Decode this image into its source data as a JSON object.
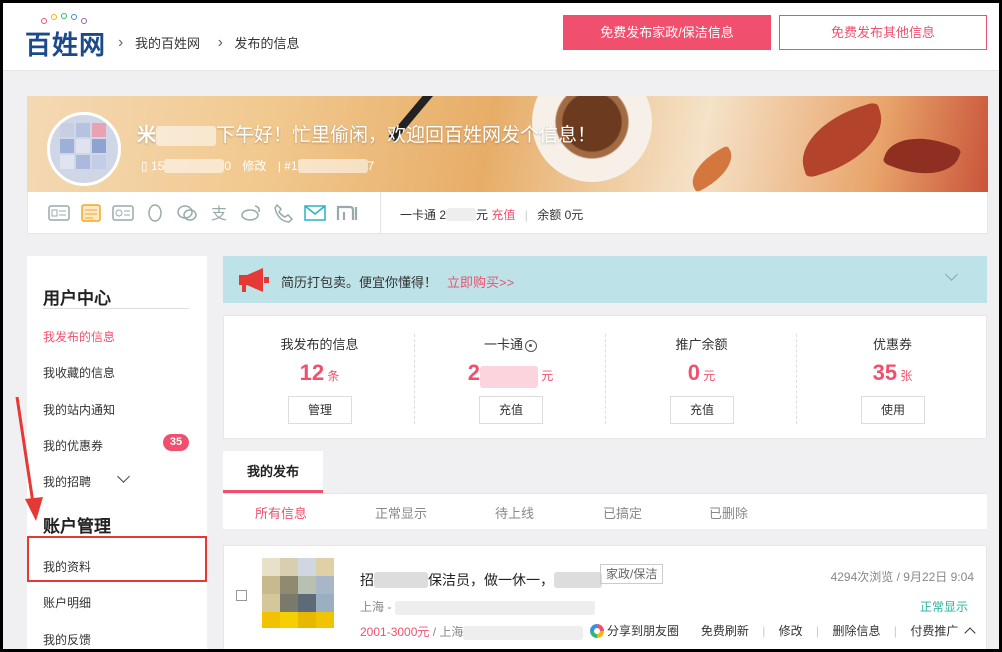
{
  "header": {
    "logo_text": "百姓网",
    "breadcrumb": [
      "我的百姓网",
      "发布的信息"
    ],
    "btn_primary": "免费发布家政/保洁信息",
    "btn_secondary": "免费发布其他信息"
  },
  "banner": {
    "name_prefix": "米",
    "greeting": "下午好！忙里偷闲，欢迎回百姓网发个信息！",
    "phone_prefix": "15",
    "phone_suffix": "0",
    "edit_label": "修改",
    "id_prefix": "#1",
    "id_suffix": "7"
  },
  "icons": [
    "id-card-icon",
    "notepad-icon",
    "card-icon",
    "qq-icon",
    "wechat-icon",
    "alipay-icon",
    "weibo-icon",
    "phone-icon",
    "mail-icon",
    "xiaomi-icon"
  ],
  "card": {
    "label": "一卡通",
    "amount_prefix": "2",
    "unit": "元",
    "recharge": "充值",
    "balance": "余额 0元"
  },
  "sidebar": {
    "section1": "用户中心",
    "items1": [
      "我发布的信息",
      "我收藏的信息",
      "我的站内通知",
      "我的优惠券",
      "我的招聘"
    ],
    "coupon_badge": "35",
    "section2": "账户管理",
    "items2": [
      "我的资料",
      "账户明细",
      "我的反馈"
    ]
  },
  "promo": {
    "text": "简历打包卖。便宜你懂得！",
    "link": "立即购买>>"
  },
  "stats": [
    {
      "label": "我发布的信息",
      "value": "12",
      "unit": "条",
      "button": "管理"
    },
    {
      "label": "一卡通",
      "value": "2",
      "unit": "元",
      "button": "充值"
    },
    {
      "label": "推广余额",
      "value": "0",
      "unit": "元",
      "button": "充值"
    },
    {
      "label": "优惠券",
      "value": "35",
      "unit": "张",
      "button": "使用"
    }
  ],
  "tabs": {
    "main": "我的发布",
    "sub": [
      "所有信息",
      "正常显示",
      "待上线",
      "已搞定",
      "已删除"
    ]
  },
  "listing": {
    "title_prefix": "招",
    "title_mid": "保洁员，做一休一，",
    "tag": "家政/保洁",
    "views": "4294次浏览 / 9月22日 9:04",
    "location": "上海 -",
    "status": "正常显示",
    "price": "2001-3000元",
    "price_loc": "/ 上海",
    "actions": [
      "分享到朋友圈",
      "免费刷新",
      "修改",
      "删除信息",
      "付费推广"
    ]
  },
  "colors": {
    "accent": "#f0506e",
    "brand": "#1b4a8b",
    "status_ok": "#27b39a",
    "annotation": "#e53935"
  }
}
